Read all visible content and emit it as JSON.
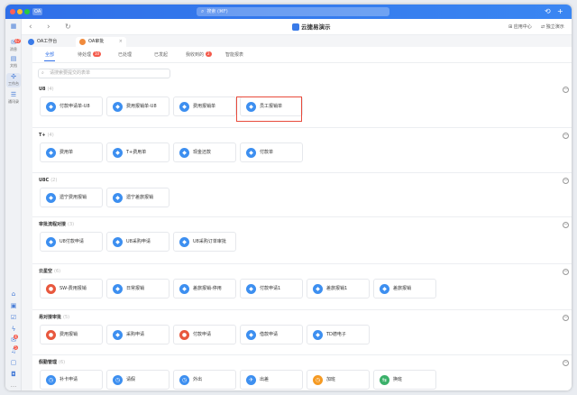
{
  "titlebar": {
    "app_badge": "OA",
    "search_placeholder": "搜索 (⌘F)",
    "history_icon": "history-icon",
    "add_icon": "plus-icon"
  },
  "sidebar": {
    "items": [
      {
        "label": "",
        "icon": "grid-icon"
      },
      {
        "label": "消息",
        "icon": "chat-icon",
        "badge": "67"
      },
      {
        "label": "文档",
        "icon": "document-icon"
      },
      {
        "label": "工作台",
        "icon": "workbench-icon"
      },
      {
        "label": "通讯录",
        "icon": "contacts-icon"
      }
    ],
    "bottom_badges": [
      "4",
      "5"
    ]
  },
  "navbar": {
    "brand": "云捷易演示",
    "app_center": "应用中心",
    "team": "独立演示"
  },
  "window_tabs": [
    {
      "label": "OA工作台"
    },
    {
      "label": "OA审批"
    }
  ],
  "subtabs": [
    {
      "label": "全部"
    },
    {
      "label": "待处理",
      "badge": "10"
    },
    {
      "label": "已处理"
    },
    {
      "label": "已发起"
    },
    {
      "label": "我收到的",
      "badge": "2"
    },
    {
      "label": "智能报表"
    }
  ],
  "search": {
    "placeholder": "请搜索要提交的表单"
  },
  "sections": [
    {
      "title": "U8",
      "count": "(4)",
      "items": [
        {
          "label": "付款申请单-U8",
          "icon": "shield-icon",
          "color": "#3d8ff0"
        },
        {
          "label": "费用报销单-U8",
          "icon": "shield-icon",
          "color": "#3d8ff0"
        },
        {
          "label": "费用报销单",
          "icon": "shield-icon",
          "color": "#3d8ff0"
        },
        {
          "label": "员工报销单",
          "icon": "shield-icon",
          "color": "#3d8ff0"
        }
      ]
    },
    {
      "title": "T+",
      "count": "(4)",
      "items": [
        {
          "label": "费用单",
          "icon": "shield-icon",
          "color": "#3d8ff0"
        },
        {
          "label": "T+费用单",
          "icon": "shield-icon",
          "color": "#3d8ff0"
        },
        {
          "label": "现金还款",
          "icon": "shield-icon",
          "color": "#3d8ff0"
        },
        {
          "label": "付款单",
          "icon": "shield-icon",
          "color": "#3d8ff0"
        }
      ]
    },
    {
      "title": "U8C",
      "count": "(2)",
      "items": [
        {
          "label": "遗宁费用报销",
          "icon": "shield-icon",
          "color": "#3d8ff0"
        },
        {
          "label": "遗宁差旅报销",
          "icon": "shield-icon",
          "color": "#3d8ff0"
        }
      ]
    },
    {
      "title": "审批流程对接",
      "count": "(3)",
      "items": [
        {
          "label": "U8付款申请",
          "icon": "shield-icon",
          "color": "#3d8ff0"
        },
        {
          "label": "U8采购申请",
          "icon": "shield-icon",
          "color": "#3d8ff0"
        },
        {
          "label": "U8采购订单审批",
          "icon": "shield-icon",
          "color": "#3d8ff0"
        }
      ]
    },
    {
      "title": "云星空",
      "count": "(6)",
      "items": [
        {
          "label": "SW-费用报销",
          "icon": "money-bag-icon",
          "color": "#e8583e"
        },
        {
          "label": "日常报销",
          "icon": "shield-icon",
          "color": "#3d8ff0"
        },
        {
          "label": "差旅报销-停用",
          "icon": "shield-icon",
          "color": "#3d8ff0"
        },
        {
          "label": "付款申请1",
          "icon": "shield-icon",
          "color": "#3d8ff0"
        },
        {
          "label": "差旅报销1",
          "icon": "shield-icon",
          "color": "#3d8ff0"
        },
        {
          "label": "差旅报销",
          "icon": "shield-icon",
          "color": "#3d8ff0"
        }
      ]
    },
    {
      "title": "易对接审批",
      "count": "(5)",
      "items": [
        {
          "label": "费用报销",
          "icon": "money-bag-icon",
          "color": "#e8583e"
        },
        {
          "label": "采购申请",
          "icon": "shield-icon",
          "color": "#3d8ff0"
        },
        {
          "label": "付款申请",
          "icon": "money-bag-icon",
          "color": "#e8583e"
        },
        {
          "label": "借款申请",
          "icon": "shield-icon",
          "color": "#3d8ff0"
        },
        {
          "label": "TD德电子",
          "icon": "shield-icon",
          "color": "#3d8ff0"
        }
      ]
    },
    {
      "title": "假勤管理",
      "count": "(6)",
      "items": [
        {
          "label": "补卡申请",
          "icon": "clock-icon",
          "color": "#3d8ff0"
        },
        {
          "label": "请假",
          "icon": "clock-icon",
          "color": "#3d8ff0"
        },
        {
          "label": "外出",
          "icon": "clock-icon",
          "color": "#3d8ff0"
        },
        {
          "label": "出差",
          "icon": "plane-icon",
          "color": "#3d8ff0"
        },
        {
          "label": "加班",
          "icon": "clock-icon",
          "color": "#f59a23"
        },
        {
          "label": "换班",
          "icon": "swap-icon",
          "color": "#3bb06a"
        }
      ]
    }
  ],
  "colors": {
    "accent": "#2f6fe8",
    "highlight": "#e84b3c"
  }
}
